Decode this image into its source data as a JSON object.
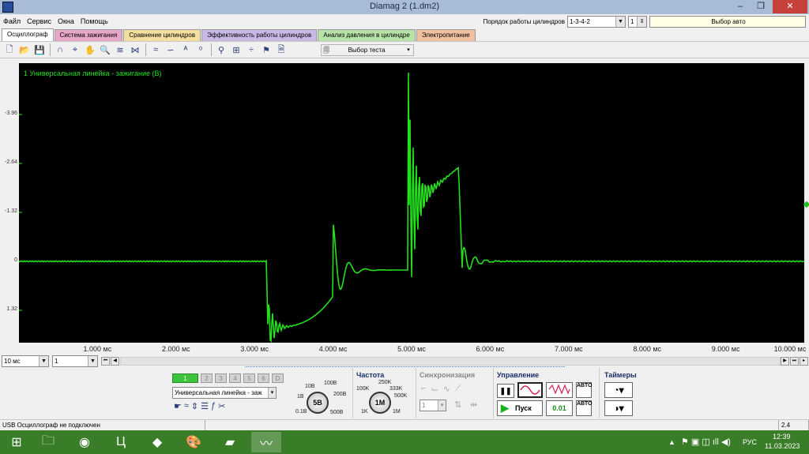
{
  "window": {
    "title": "Diamag 2 (1.dm2)",
    "min": "–",
    "max": "❐",
    "close": "✕"
  },
  "menu": {
    "items": [
      "Файл",
      "Сервис",
      "Окна",
      "Помощь"
    ],
    "cylinder_order_label": "Порядок работы цилиндров",
    "cylinder_order_value": "1-3-4-2",
    "cylinder_number": "1",
    "auto_select": "Выбор авто"
  },
  "tabs": [
    {
      "label": "Осциллограф",
      "color": "#ffffff"
    },
    {
      "label": "Система зажигания",
      "color": "#e7a7c9"
    },
    {
      "label": "Сравнение цилиндров",
      "color": "#f4dfa0"
    },
    {
      "label": "Эффективность работы цилиндров",
      "color": "#c7b8e6"
    },
    {
      "label": "Анализ давления в цилиндре",
      "color": "#b7e3a8"
    },
    {
      "label": "Электропитание",
      "color": "#f1c0a0"
    }
  ],
  "toolbar": {
    "icons": [
      "new-file-icon",
      "open-folder-icon",
      "save-icon",
      "wave-icon",
      "cursor-icon",
      "hand-icon",
      "zoom-icon",
      "wave-multi-icon",
      "split-wave-icon",
      "stack-wave-icon",
      "phase-wave-icon",
      "auto-icon",
      "zero-icon",
      "filter-icon",
      "table-icon",
      "divide-icon",
      "flag-icon",
      "page-icon"
    ],
    "test_select": "Выбор теста"
  },
  "scope": {
    "channel_label": "1 Универсальная линейка - зажигание (В)",
    "trace_color": "#22e01c",
    "y_ticks": [
      "-3.96",
      "-2.64",
      "-1.32",
      "0",
      "1.32"
    ],
    "x_ticks": [
      "1.000 мс",
      "2.000 мс",
      "3.000 мс",
      "4.000 мс",
      "5.000 мс",
      "6.000 мс",
      "7.000 мс",
      "8.000 мс",
      "9.000 мс",
      "10.000 мс"
    ]
  },
  "scrollbar": {
    "timebase": "10 мс",
    "channel": "1"
  },
  "panel": {
    "channels": [
      "1",
      "2",
      "3",
      "4",
      "5",
      "6",
      "D"
    ],
    "probe_select": "Универсальная линейка - заж",
    "range_labels": [
      "10В",
      "100В",
      "1В",
      "200В",
      "0.1В",
      "500В"
    ],
    "range_value": "5В",
    "freq_title": "Частота",
    "freq_labels": [
      "250K",
      "100K",
      "333K",
      "500K",
      "1K",
      "1M"
    ],
    "freq_value": "1M",
    "sync_title": "Синхронизация",
    "sync_value": "1",
    "control_title": "Управление",
    "start_label": "Пуск",
    "step_value": "0.01",
    "timers_title": "Таймеры",
    "auto_label": "АВТО"
  },
  "status": {
    "left": "USB Осциллограф не подключен",
    "right": "2.4"
  },
  "taskbar": {
    "apps": [
      "windows-start-icon",
      "file-explorer-icon",
      "chrome-icon",
      "office-icon",
      "visual-studio-icon",
      "paint-icon",
      "notes-icon",
      "diamag-icon"
    ],
    "lang": "РУС",
    "time": "12:39",
    "date": "11.03.2023"
  }
}
